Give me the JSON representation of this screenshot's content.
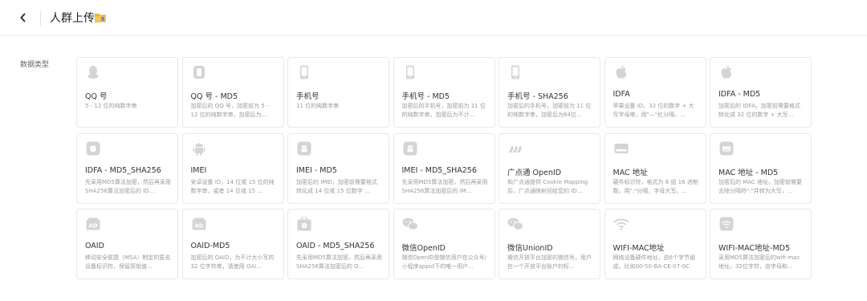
{
  "header": {
    "title": "人群上传"
  },
  "section": {
    "label": "数据类型"
  },
  "colors": {
    "icon": "#d4d4d4",
    "folder": "#e8b341"
  },
  "cards": [
    {
      "name": "QQ 号",
      "desc": "5 - 12 位的纯数字串",
      "icon": "qq-icon"
    },
    {
      "name": "QQ 号 - MD5",
      "desc": "加密后的 QQ 号，加密前为 5 - 12 位的纯数字串，加密后为...",
      "icon": "phone-icon"
    },
    {
      "name": "手机号",
      "desc": "11 位的纯数字串",
      "icon": "mobile-icon"
    },
    {
      "name": "手机号 - MD5",
      "desc": "加密后的手机号，加密前为 11 位的纯数字串，加密后为不计...",
      "icon": "mobile-icon"
    },
    {
      "name": "手机号 - SHA256",
      "desc": "加密后的手机号，加密前为 11 位的纯数字串，加密后为64位...",
      "icon": "mobile-icon"
    },
    {
      "name": "IDFA",
      "desc": "苹果设备 ID，32 位的数字 + 大写字母串，用\"—\"杠分隔，...",
      "icon": "apple-icon"
    },
    {
      "name": "IDFA - MD5",
      "desc": "加密后的 IDFA，加密前需要格式转化成 32 位的数字 + 大写...",
      "icon": "apple-icon"
    },
    {
      "name": "IDFA - MD5_SHA256",
      "desc": "先采用MD5算法加密，然后再采用SHA256算法加密后的 ID...",
      "icon": "apple-square-icon"
    },
    {
      "name": "IMEI",
      "desc": "安卓设备 ID，14 位或 15 位的纯数字串，或者 14 位或 15 ...",
      "icon": "android-icon"
    },
    {
      "name": "IMEI - MD5",
      "desc": "加密后的 IMEI，加密前需要格式转化成 14 位或 15 位数字 ...",
      "icon": "android-square-icon"
    },
    {
      "name": "IMEI - MD5_SHA256",
      "desc": "先采用MD5算法加密，然后再采用SHA256算法加密后的 IM...",
      "icon": "android-square-icon"
    },
    {
      "name": "广点通 OpenID",
      "desc": "和广点通提供 Cookie Mapping 后，广点通映射回给您的 ID...",
      "icon": "gdt-icon"
    },
    {
      "name": "MAC 地址",
      "desc": "硬件标识符，格式为 6 组 16 进制数，用\":\"分隔，字母大写。...",
      "icon": "mac-icon"
    },
    {
      "name": "MAC 地址 - MD5",
      "desc": "加密后的 MAC 地址，加密前需要去除分隔符\":\"并转为大写，...",
      "icon": "mac-square-icon"
    },
    {
      "name": "OAID",
      "desc": "移动安全联盟（MSA）制定的匿名设备标识符，保留原始值...",
      "icon": "ad-icon"
    },
    {
      "name": "OAID-MD5",
      "desc": "加密后的 OAID，为不计大小写的 32 位字符串，请使用 OAI...",
      "icon": "ad-icon"
    },
    {
      "name": "OAID - MD5_SHA256",
      "desc": "先采用MD5算法加密，然后再采用SHA256算法加密后的 O...",
      "icon": "ad-lock-icon"
    },
    {
      "name": "微信OpenID",
      "desc": "微信OpenID是微信用户在公众号/小程序appid下的唯一用户...",
      "icon": "wechat-icon"
    },
    {
      "name": "微信UnionID",
      "desc": "微信开放平台加密的微信号，用户在一个开放平台账户的标...",
      "icon": "wechat-icon"
    },
    {
      "name": "WIFI-MAC地址",
      "desc": "网络设备硬件地址，由6个字节组成，比如00-50-BA-CE-07-0C",
      "icon": "wifi-icon"
    },
    {
      "name": "WIFI-MAC地址-MD5",
      "desc": "采用MD5算法加密后的wifi-mac地址，32位字符，由字母和...",
      "icon": "wifi-square-icon"
    }
  ]
}
